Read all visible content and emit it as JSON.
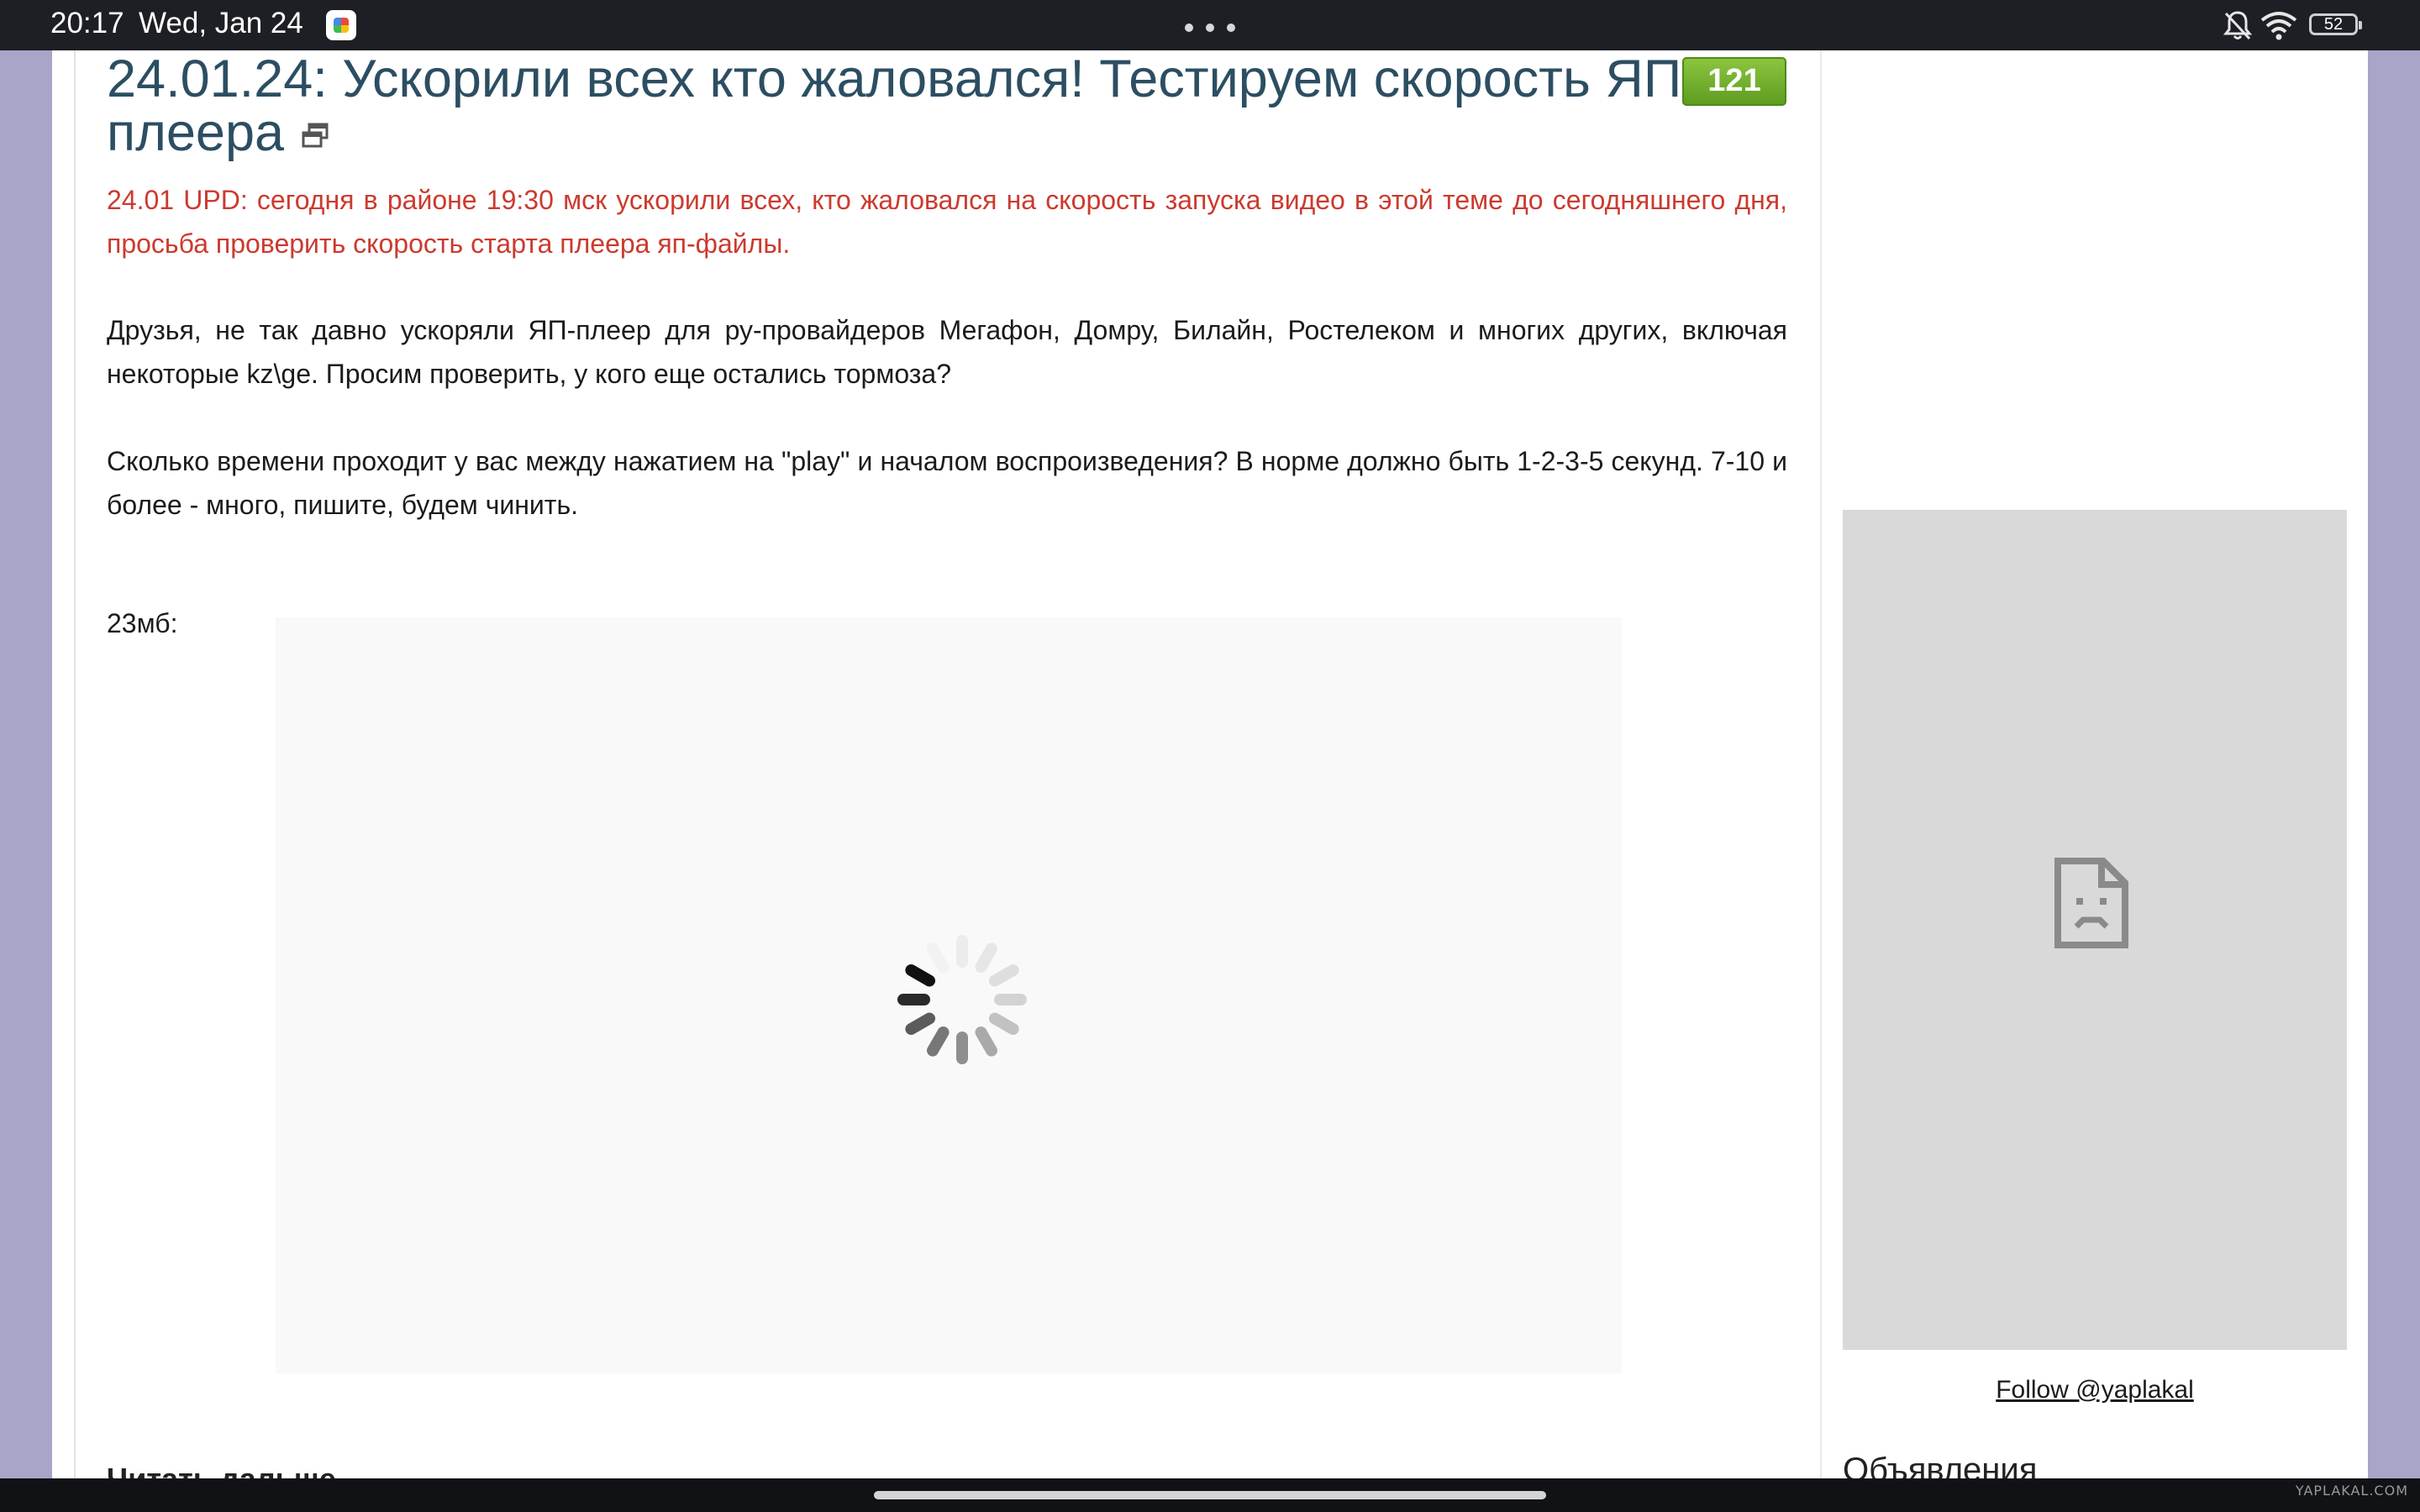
{
  "status_bar": {
    "time": "20:17",
    "date": "Wed, Jan 24",
    "battery_level": "52"
  },
  "post": {
    "title": "24.01.24: Ускорили всех кто жаловался! Тестируем скорость ЯП-плеера",
    "comment_count": "121",
    "update_note": "24.01 UPD: сегодня в районе 19:30 мск ускорили всех, кто жаловался на скорость запуска видео в этой теме до сегодняшнего дня, просьба проверить скорость старта плеера яп-файлы.",
    "paragraph1": "Друзья, не так давно ускоряли ЯП-плеер для ру-провайдеров Мегафон, Домру, Билайн, Ростелеком и многих других, включая некоторые kz\\ge. Просим проверить, у кого еще остались тормоза?",
    "paragraph2": "Сколько времени проходит у вас между нажатием на \"play\" и началом воспроизведения? В норме должно быть 1-2-3-5 секунд. 7-10 и более - много, пишите, будем чинить.",
    "video_size_label": "23мб:",
    "read_more": "Читать дальше"
  },
  "sidebar": {
    "follow_link": "Follow @yaplakal",
    "ads_heading": "Объявления"
  },
  "watermark": "YAPLAKAL.COM",
  "colors": {
    "title": "#2c4e62",
    "update_text": "#cc3a2f",
    "badge_green": "#6aa72a"
  }
}
